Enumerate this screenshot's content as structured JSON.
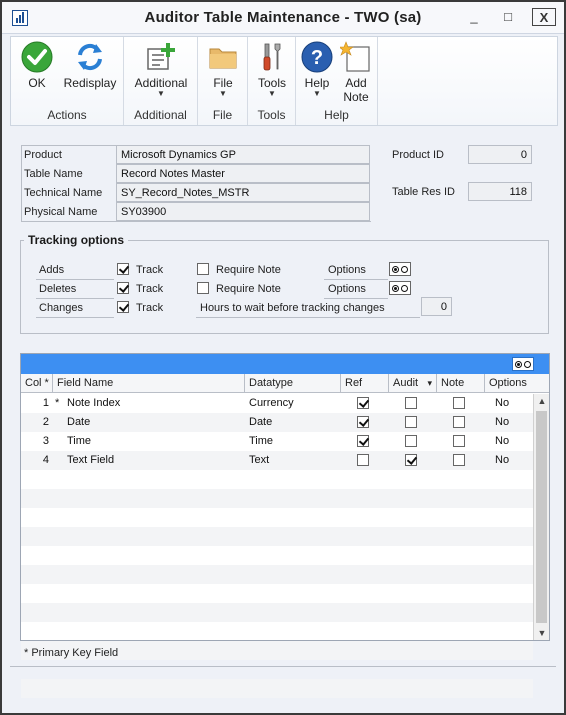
{
  "window": {
    "title": "Auditor Table Maintenance  -  TWO (sa)",
    "min_label": "_",
    "max_label": "□",
    "close_label": "X"
  },
  "ribbon": {
    "groups": [
      {
        "label": "Actions",
        "buttons": [
          {
            "label": "OK",
            "icon": "ok-check-icon"
          },
          {
            "label": "Redisplay",
            "icon": "redisplay-icon"
          }
        ]
      },
      {
        "label": "Additional",
        "buttons": [
          {
            "label": "Additional",
            "icon": "additional-icon",
            "dropdown": true
          }
        ]
      },
      {
        "label": "File",
        "buttons": [
          {
            "label": "File",
            "icon": "folder-icon",
            "dropdown": true
          }
        ]
      },
      {
        "label": "Tools",
        "buttons": [
          {
            "label": "Tools",
            "icon": "tools-icon",
            "dropdown": true
          }
        ]
      },
      {
        "label": "Help",
        "buttons": [
          {
            "label": "Help",
            "icon": "help-icon",
            "dropdown": true
          },
          {
            "label": "Add\nNote",
            "label_line1": "Add",
            "label_line2": "Note",
            "icon": "add-note-icon"
          }
        ]
      }
    ],
    "dropdown_glyph": "▼"
  },
  "header": {
    "product_label": "Product",
    "product_value": "Microsoft Dynamics GP",
    "table_name_label": "Table Name",
    "table_name_value": "Record Notes Master",
    "technical_name_label": "Technical Name",
    "technical_name_value": "SY_Record_Notes_MSTR",
    "physical_name_label": "Physical Name",
    "physical_name_value": "SY03900",
    "product_id_label": "Product ID",
    "product_id_value": "0",
    "table_res_id_label": "Table Res ID",
    "table_res_id_value": "118"
  },
  "tracking": {
    "title": "Tracking options",
    "rows": [
      {
        "label": "Adds",
        "track_label": "Track",
        "track_checked": true,
        "require_label": "Require Note",
        "require_checked": false,
        "options_label": "Options"
      },
      {
        "label": "Deletes",
        "track_label": "Track",
        "track_checked": true,
        "require_label": "Require Note",
        "require_checked": false,
        "options_label": "Options"
      },
      {
        "label": "Changes",
        "track_label": "Track",
        "track_checked": true
      }
    ],
    "hours_label": "Hours to wait before tracking changes",
    "hours_value": "0"
  },
  "grid": {
    "columns": [
      "Col *",
      "Field Name",
      "Datatype",
      "Ref",
      "Audit",
      "Note",
      "Options"
    ],
    "audit_sort_glyph": "▾",
    "rows": [
      {
        "col": "1",
        "key_marker": "*",
        "field": "Note Index",
        "datatype": "Currency",
        "ref": true,
        "audit": false,
        "note": false,
        "options": "No"
      },
      {
        "col": "2",
        "key_marker": "",
        "field": "Date",
        "datatype": "Date",
        "ref": true,
        "audit": false,
        "note": false,
        "options": "No"
      },
      {
        "col": "3",
        "key_marker": "",
        "field": "Time",
        "datatype": "Time",
        "ref": true,
        "audit": false,
        "note": false,
        "options": "No"
      },
      {
        "col": "4",
        "key_marker": "",
        "field": "Text Field",
        "datatype": "Text",
        "ref": false,
        "audit": true,
        "note": false,
        "options": "No"
      }
    ],
    "empty_rows": 12,
    "scroll_up_glyph": "▲",
    "scroll_down_glyph": "▼"
  },
  "footer": {
    "note": "* Primary Key Field"
  },
  "colors": {
    "grid_bar": "#3d8ff2",
    "ok_green": "#3aa63a",
    "help_blue": "#2a5fb0"
  }
}
